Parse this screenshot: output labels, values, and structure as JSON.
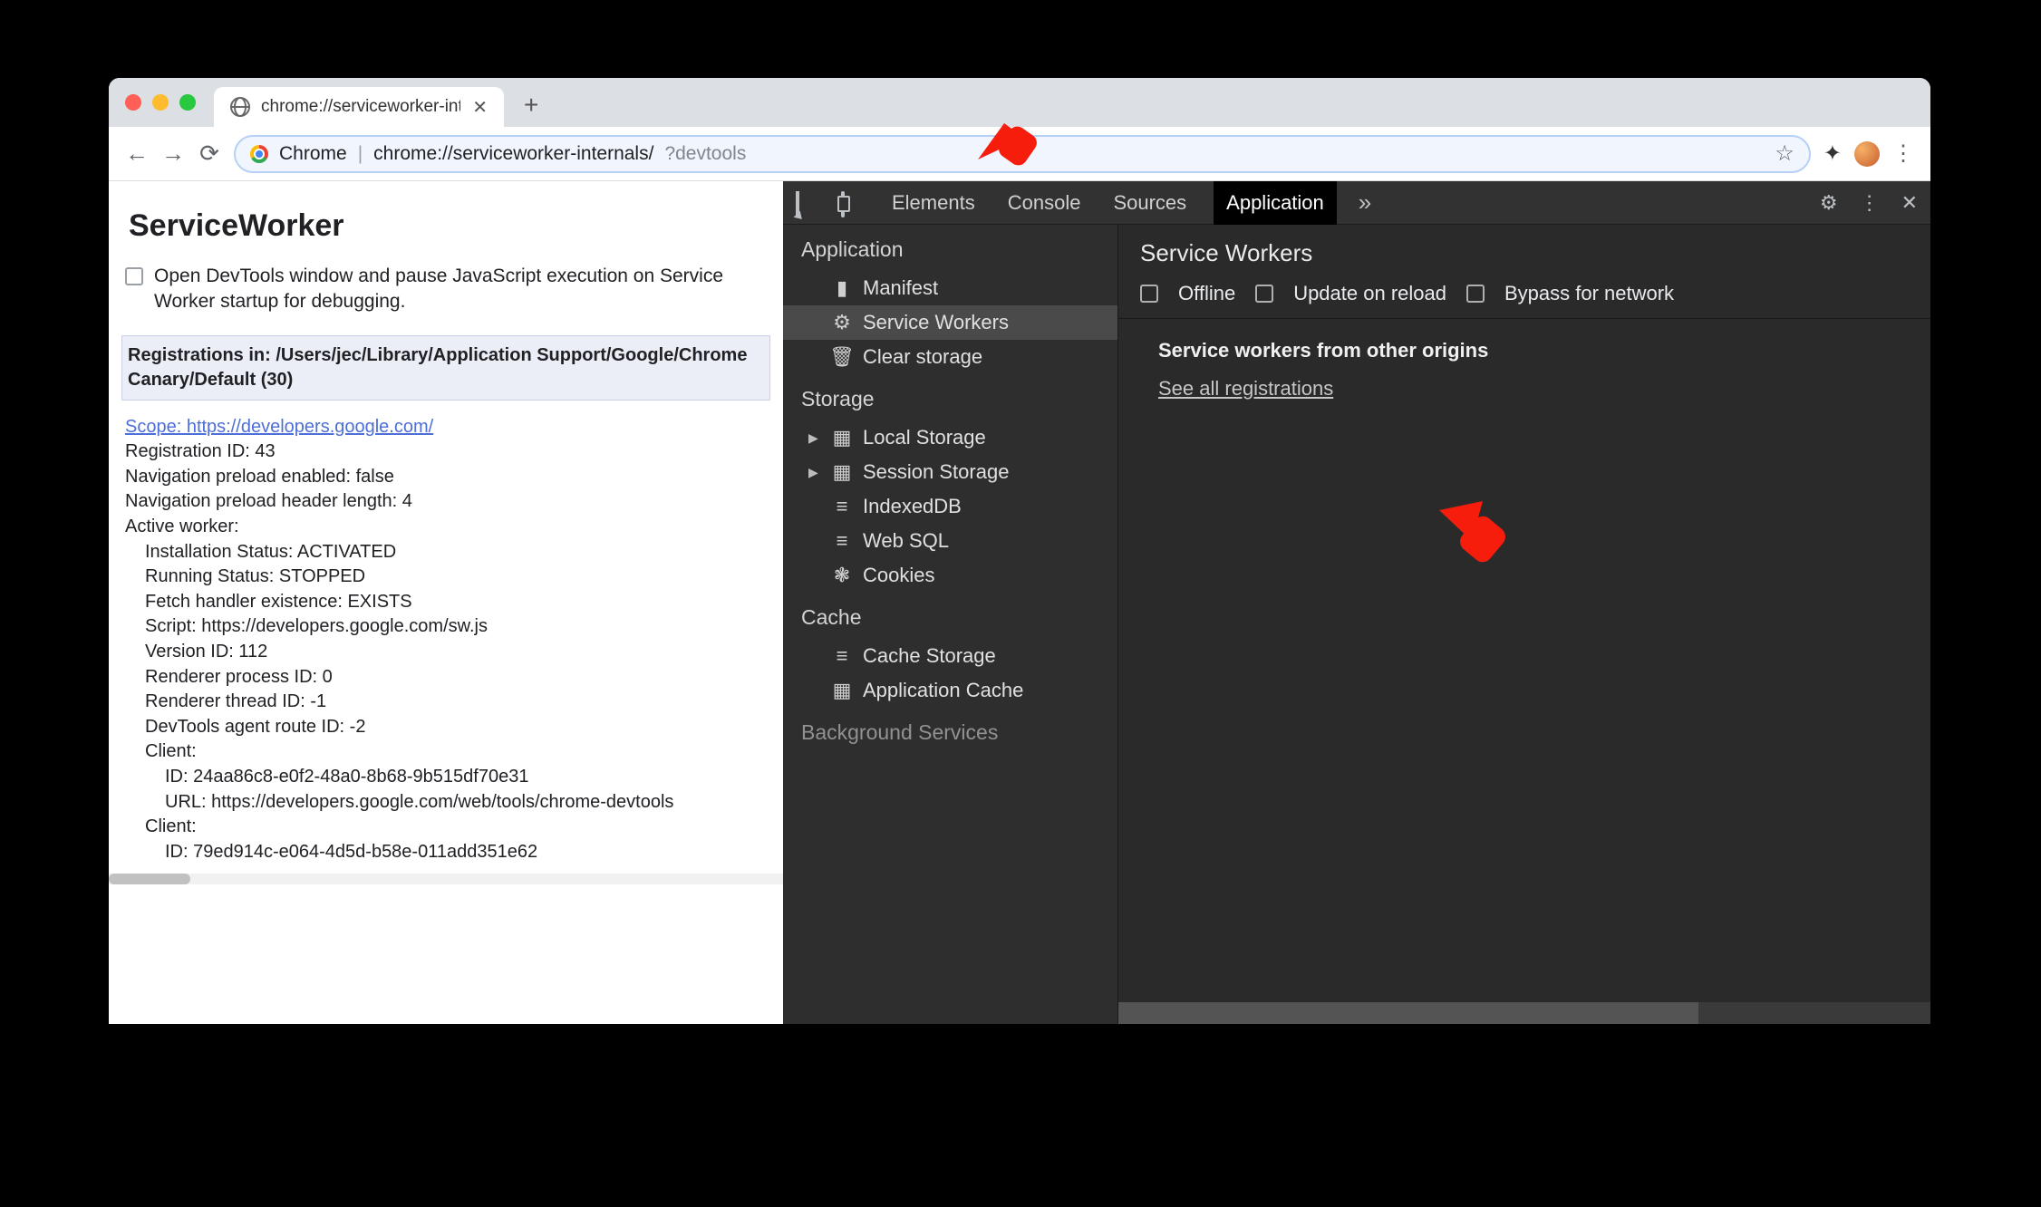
{
  "window": {
    "tab_title": "chrome://serviceworker-intern"
  },
  "omnibox": {
    "origin_label": "Chrome",
    "path": "chrome://serviceworker-internals/",
    "query": "?devtools"
  },
  "page": {
    "heading": "ServiceWorker",
    "debug_checkbox_label": "Open DevTools window and pause JavaScript execution on Service Worker startup for debugging.",
    "registrations_header": "Registrations in: /Users/jec/Library/Application Support/Google/Chrome Canary/Default (30)",
    "scope_label": "Scope: https://developers.google.com/",
    "lines": [
      "Registration ID: 43",
      "Navigation preload enabled: false",
      "Navigation preload header length: 4",
      "Active worker:"
    ],
    "active_worker_lines": [
      "Installation Status: ACTIVATED",
      "Running Status: STOPPED",
      "Fetch handler existence: EXISTS",
      "Script: https://developers.google.com/sw.js",
      "Version ID: 112",
      "Renderer process ID: 0",
      "Renderer thread ID: -1",
      "DevTools agent route ID: -2",
      "Client:"
    ],
    "client1_lines": [
      "ID: 24aa86c8-e0f2-48a0-8b68-9b515df70e31",
      "URL: https://developers.google.com/web/tools/chrome-devtools"
    ],
    "client2_label": "Client:",
    "client2_lines": [
      "ID: 79ed914c-e064-4d5d-b58e-011add351e62"
    ]
  },
  "devtools": {
    "tabs": [
      "Elements",
      "Console",
      "Sources",
      "Application"
    ],
    "active_tab": "Application",
    "sidebar": {
      "application": {
        "title": "Application",
        "items": [
          "Manifest",
          "Service Workers",
          "Clear storage"
        ]
      },
      "storage": {
        "title": "Storage",
        "items": [
          "Local Storage",
          "Session Storage",
          "IndexedDB",
          "Web SQL",
          "Cookies"
        ]
      },
      "cache": {
        "title": "Cache",
        "items": [
          "Cache Storage",
          "Application Cache"
        ]
      },
      "background": {
        "title": "Background Services"
      }
    },
    "main": {
      "title": "Service Workers",
      "checks": [
        "Offline",
        "Update on reload",
        "Bypass for network"
      ],
      "other_origins_title": "Service workers from other origins",
      "see_all_link": "See all registrations"
    }
  }
}
